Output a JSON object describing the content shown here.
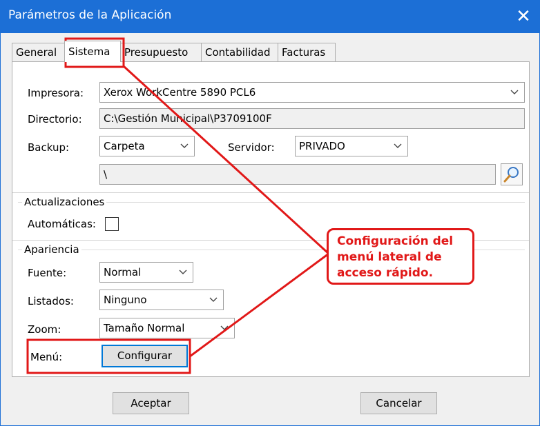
{
  "window": {
    "title": "Parámetros de la Aplicación",
    "close_glyph": "✕",
    "titlebar_color": "#1c6fd6"
  },
  "tabs": [
    {
      "label": "General"
    },
    {
      "label": "Sistema",
      "active": true
    },
    {
      "label": "Presupuesto"
    },
    {
      "label": "Contabilidad"
    },
    {
      "label": "Facturas"
    }
  ],
  "sistema": {
    "impresora": {
      "label": "Impresora:",
      "value": "Xerox WorkCentre 5890 PCL6"
    },
    "directorio": {
      "label": "Directorio:",
      "value": "C:\\Gestión Municipal\\P3709100F"
    },
    "backup": {
      "label": "Backup:",
      "value": "Carpeta"
    },
    "servidor": {
      "label": "Servidor:",
      "value": "PRIVADO"
    },
    "backup_path": {
      "value": "\\"
    },
    "actualizaciones": {
      "title": "Actualizaciones",
      "automaticas_label": "Automáticas:",
      "automaticas_checked": false
    },
    "apariencia": {
      "title": "Apariencia",
      "fuente": {
        "label": "Fuente:",
        "value": "Normal"
      },
      "listados": {
        "label": "Listados:",
        "value": "Ninguno"
      },
      "zoom": {
        "label": "Zoom:",
        "value": "Tamaño Normal"
      },
      "menu": {
        "label": "Menú:",
        "button_label": "Configurar"
      }
    }
  },
  "footer": {
    "accept_label": "Aceptar",
    "cancel_label": "Cancelar"
  },
  "annotation": {
    "lines": [
      "Configuración del",
      "menú lateral de",
      "acceso rápido."
    ],
    "color": "#e11818"
  }
}
